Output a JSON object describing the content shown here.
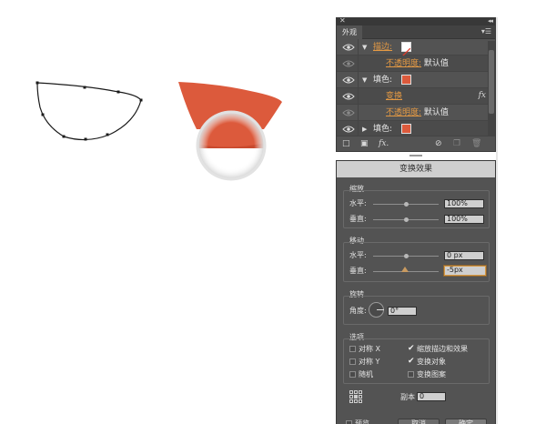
{
  "appearance_panel": {
    "tab": "外观",
    "rows": [
      {
        "label": "描边:",
        "kind": "stroke"
      },
      {
        "label": "不透明度:",
        "value": "默认值"
      },
      {
        "label": "填色:",
        "kind": "fill"
      },
      {
        "label": "变换",
        "fx": "fx"
      },
      {
        "label": "不透明度:",
        "value": "默认值"
      },
      {
        "label": "填色:",
        "kind": "fill"
      }
    ],
    "bottom_fx": "fx."
  },
  "transform_dialog": {
    "title": "变换效果",
    "scale": {
      "title": "缩放",
      "h_label": "水平:",
      "h_value": "100%",
      "h_level": 0.5,
      "v_label": "垂直:",
      "v_value": "100%",
      "v_level": 0.5
    },
    "move": {
      "title": "移动",
      "h_label": "水平:",
      "h_value": "0 px",
      "h_level": 0.5,
      "v_label": "垂直:",
      "v_value": "-5px",
      "v_level": 0.48
    },
    "rotate": {
      "title": "旋转",
      "angle_label": "角度:",
      "angle_value": "0°"
    },
    "options": {
      "title": "选项",
      "items": [
        {
          "label": "对称 X",
          "checked": false
        },
        {
          "label": "缩放描边和效果",
          "checked": true
        },
        {
          "label": "对称 Y",
          "checked": false
        },
        {
          "label": "变换对象",
          "checked": true
        },
        {
          "label": "随机",
          "checked": false
        },
        {
          "label": "变换图案",
          "checked": false
        }
      ]
    },
    "copies_label": "副本",
    "copies_value": "0",
    "preview_label": "预览",
    "cancel_label": "取消",
    "ok_label": "确定"
  },
  "colors": {
    "fill": "#dc5a3c",
    "fill_dark": "#c94a2e",
    "panel_bg": "#535353",
    "accent_link": "#e59a44"
  }
}
